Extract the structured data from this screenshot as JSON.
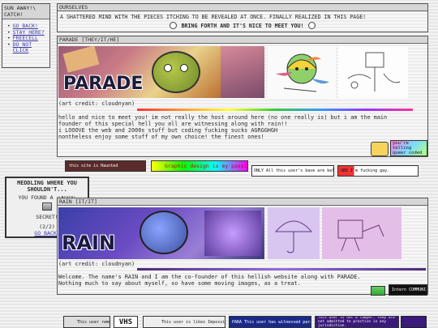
{
  "nav": {
    "header": "SUN AWAY!\\ CATCH!",
    "items": [
      {
        "label": "GO BACK!"
      },
      {
        "label": "STAY HERE?"
      },
      {
        "label": "FREECELL"
      },
      {
        "label": "DO NOT CLICK"
      }
    ]
  },
  "top": {
    "header": "OURSELVES",
    "line1": "A SHATTERED MIND WITH THE PIECES ITCHING TO BE REVEALED AT ONCE. FINALLY REALIZED IN THIS PAGE!",
    "line2": "BRING FORTH AND IT'S NICE TO MEET YOU!"
  },
  "parade": {
    "header": "PARADE [THEY/IT/HE]",
    "logo": "PARADE",
    "credit": "(art credit: cloudnyan)",
    "bio": [
      "hello and nice to meet you! im not really the host around here (no one really is) but i am the main",
      "founder of this special hell you all are witnessing along with rain!!",
      "i LOOOVE the web and 2000s stuff but coding fucking sucks AGRGGHGH",
      "nontheless enjoy some stuff of my own choice! the finest ones!"
    ],
    "badges": [
      {
        "text": "this site is Haunted"
      },
      {
        "text": "Graphic design is my passion"
      },
      {
        "text": "ONLY All this user's base are belong to Internet memes."
      },
      {
        "text": "UBX I'm fucking gay."
      },
      {
        "text": "you're telling queer coded"
      }
    ]
  },
  "popup": {
    "title": "MEDDLING WHERE YOU SHOULDN'T...",
    "found": "YOU FOUND A",
    "legacy": "(LEGACY)",
    "secret": "SECRET!",
    "count": "(2/2)",
    "back": "GO BACK?"
  },
  "rain": {
    "header": "RAIN [IT/IT]",
    "logo": "RAIN",
    "credit": "(art credit: cloudnyan)",
    "bio": [
      "Welcome. The name's RAIN and I am the co-founder of this hellish website along with PARADE.",
      "Nothing much to say about myself, so have some moving images, as a treat."
    ],
    "badges": [
      {
        "text": "This user remembers VHS"
      },
      {
        "text": "VHS"
      },
      {
        "text": "This user is likes Impossible Objects"
      },
      {
        "text": "PARA This user has witnessed paranormal activity"
      },
      {
        "text": "This user is not a lawyer. They are not admitted to practice in any jurisdiction."
      },
      {
        "text": "Intern COMMUNI"
      }
    ]
  },
  "colors": {
    "link": "#3a3aa8",
    "header_bg": "#d6d6d6"
  }
}
